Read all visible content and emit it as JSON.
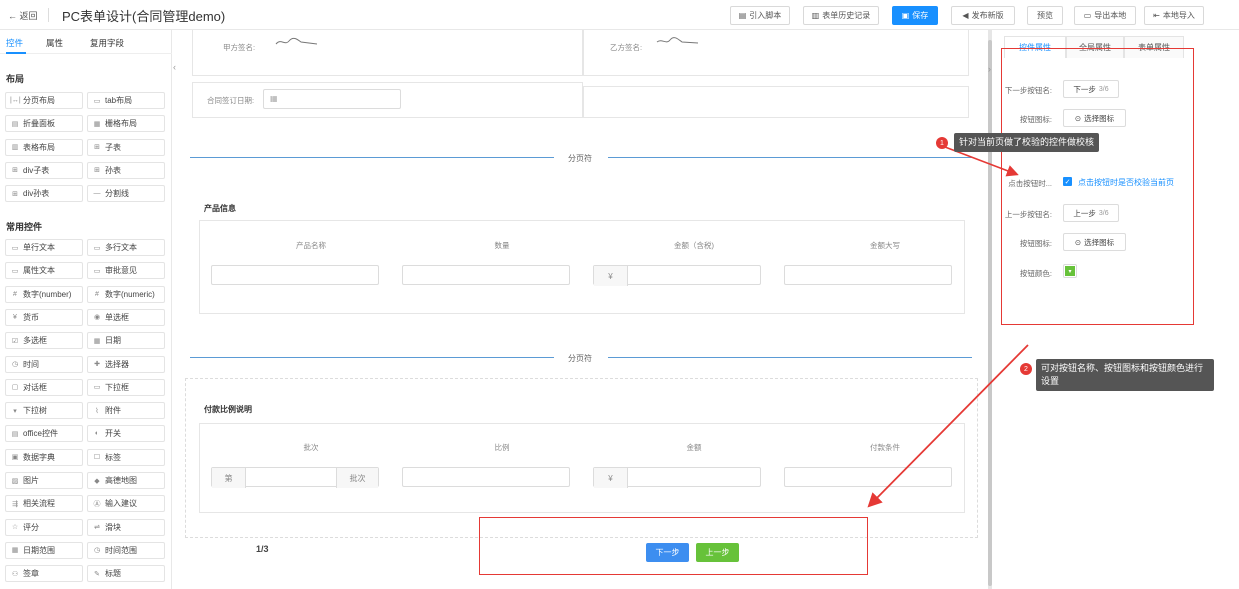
{
  "topbar": {
    "back": "← 返回",
    "title": "PC表单设计(合同管理demo)",
    "buttons": {
      "import_script": "引入脚本",
      "history": "表单历史记录",
      "save": "保存",
      "publish": "发布新版",
      "preview": "预览",
      "export": "导出本地",
      "import_local": "本地导入"
    }
  },
  "sidebar": {
    "tabs": [
      "控件",
      "属性",
      "复用字段"
    ],
    "sections": {
      "layout": "布局",
      "common": "常用控件"
    },
    "layout_items": [
      {
        "icon": "|↔|",
        "label": "分页布局"
      },
      {
        "icon": "▭",
        "label": "tab布局"
      },
      {
        "icon": "▤",
        "label": "折叠面板"
      },
      {
        "icon": "▦",
        "label": "栅格布局"
      },
      {
        "icon": "▥",
        "label": "表格布局"
      },
      {
        "icon": "⊞",
        "label": "子表"
      },
      {
        "icon": "⊞",
        "label": "div子表"
      },
      {
        "icon": "⊞",
        "label": "孙表"
      },
      {
        "icon": "⊞",
        "label": "div孙表"
      },
      {
        "icon": "—",
        "label": "分割线"
      }
    ],
    "common_items": [
      {
        "icon": "▭",
        "label": "单行文本"
      },
      {
        "icon": "▭",
        "label": "多行文本"
      },
      {
        "icon": "▭",
        "label": "属性文本"
      },
      {
        "icon": "▭",
        "label": "审批意见"
      },
      {
        "icon": "#",
        "label": "数字(number)"
      },
      {
        "icon": "#",
        "label": "数字(numeric)"
      },
      {
        "icon": "¥",
        "label": "货币"
      },
      {
        "icon": "◉",
        "label": "单选框"
      },
      {
        "icon": "☑",
        "label": "多选框"
      },
      {
        "icon": "▦",
        "label": "日期"
      },
      {
        "icon": "◷",
        "label": "时间"
      },
      {
        "icon": "✚",
        "label": "选择器"
      },
      {
        "icon": "▢",
        "label": "对话框"
      },
      {
        "icon": "▭",
        "label": "下拉框"
      },
      {
        "icon": "▾",
        "label": "下拉树"
      },
      {
        "icon": "⌇",
        "label": "附件"
      },
      {
        "icon": "▤",
        "label": "office控件"
      },
      {
        "icon": "◐",
        "label": "开关"
      },
      {
        "icon": "▣",
        "label": "数据字典"
      },
      {
        "icon": "☐",
        "label": "标签"
      },
      {
        "icon": "▨",
        "label": "图片"
      },
      {
        "icon": "◆",
        "label": "高德地图"
      },
      {
        "icon": "⇶",
        "label": "相关流程"
      },
      {
        "icon": "Ⓐ",
        "label": "输入建议"
      },
      {
        "icon": "☆",
        "label": "评分"
      },
      {
        "icon": "⇌",
        "label": "滑块"
      },
      {
        "icon": "▦",
        "label": "日期范围"
      },
      {
        "icon": "◷",
        "label": "时间范围"
      },
      {
        "icon": "⚇",
        "label": "签章"
      },
      {
        "icon": "✎",
        "label": "标题"
      }
    ]
  },
  "canvas": {
    "sign_a_label": "甲方签名:",
    "sign_b_label": "乙方签名:",
    "contract_date_label": "合同签订日期:",
    "page_sep_label": "分页符",
    "product_section": {
      "title": "产品信息",
      "headers": [
        "产品名称",
        "数量",
        "金额（含税)",
        "金额大写"
      ],
      "currency": "¥"
    },
    "payment_section": {
      "title": "付款比例说明",
      "headers": [
        "批次",
        "比例",
        "金额",
        "付款条件"
      ],
      "prefix": "第",
      "suffix": "批次",
      "currency": "¥"
    },
    "page_indicator": "1/3",
    "next_button": "下一步",
    "prev_button": "上一步"
  },
  "right_panel": {
    "tabs": [
      "控件属性",
      "全局属性",
      "表单属性"
    ],
    "next_name_label": "下一步按钮名:",
    "next_name_value": "下一步",
    "next_name_count": "3/6",
    "btn_icon_label": "按钮图标:",
    "select_icon": "选择图标",
    "validate_label": "点击按钮时...",
    "validate_checkbox": "点击按钮时是否校验当前页",
    "prev_name_label": "上一步按钮名:",
    "prev_name_value": "上一步",
    "prev_name_count": "3/6",
    "btn_color_label": "按钮颜色:"
  },
  "annotations": {
    "tip1_num": "1",
    "tip1": "针对当前页做了校验的控件做校核",
    "tip2_num": "2",
    "tip2": "可对按钮名称、按钮图标和按钮颜色进行设置"
  },
  "colors": {
    "accent": "#1890ff",
    "next_btn": "#3d8ef0",
    "prev_btn": "#67c23a",
    "annotation_red": "#e53935",
    "page_sep": "#5b9bd5"
  }
}
